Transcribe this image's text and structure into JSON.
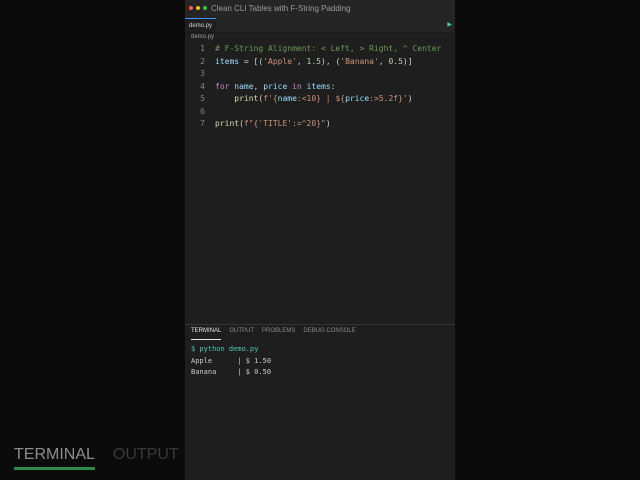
{
  "window": {
    "title": "Clean CLI Tables with F-String Padding",
    "active_tab": "demo.py",
    "breadcrumb": "demo.py",
    "run_icon": "play-icon"
  },
  "code": {
    "line_numbers": [
      "1",
      "2",
      "3",
      "4",
      "5",
      "6",
      "7"
    ],
    "line1": {
      "comment": "# F-String Alignment: < Left, > Right, ^ Center"
    },
    "line2": {
      "var": "items",
      "eq": " = [(",
      "s1": "'Apple'",
      "c1": ", ",
      "n1": "1.5",
      "p1": "), (",
      "s2": "'Banana'",
      "c2": ", ",
      "n2": "0.5",
      "end": ")]"
    },
    "line4": {
      "kw1": "for",
      "sp1": " ",
      "v1": "name",
      "c1": ", ",
      "v2": "price",
      "sp2": " ",
      "kw2": "in",
      "sp3": " ",
      "v3": "items",
      "end": ":"
    },
    "line5": {
      "indent": "    ",
      "fn": "print",
      "open": "(",
      "fstr_start": "f'{",
      "v1": "name",
      "fmt1": ":<10} | ${",
      "v2": "price",
      "fmt2": ":>5.2f}'",
      "close": ")"
    },
    "line7": {
      "fn": "print",
      "open": "(",
      "str": "f\"{'TITLE':=^20}\"",
      "close": ")"
    }
  },
  "panel": {
    "tabs": [
      "TERMINAL",
      "OUTPUT",
      "PROBLEMS",
      "DEBUG CONSOLE"
    ],
    "active_tab": "TERMINAL",
    "terminal": {
      "command": "$ python demo.py",
      "output": [
        "Apple      | $ 1.50",
        "Banana     | $ 0.50"
      ]
    }
  },
  "background": {
    "tabs": [
      "TERMINAL",
      "OUTPUT"
    ]
  },
  "colors": {
    "editor_bg": "#1e1e1e",
    "comment": "#6a9955",
    "keyword": "#c586c0",
    "variable": "#9cdcfe",
    "string": "#ce9178",
    "number": "#b5cea8",
    "function": "#dcdcaa"
  }
}
